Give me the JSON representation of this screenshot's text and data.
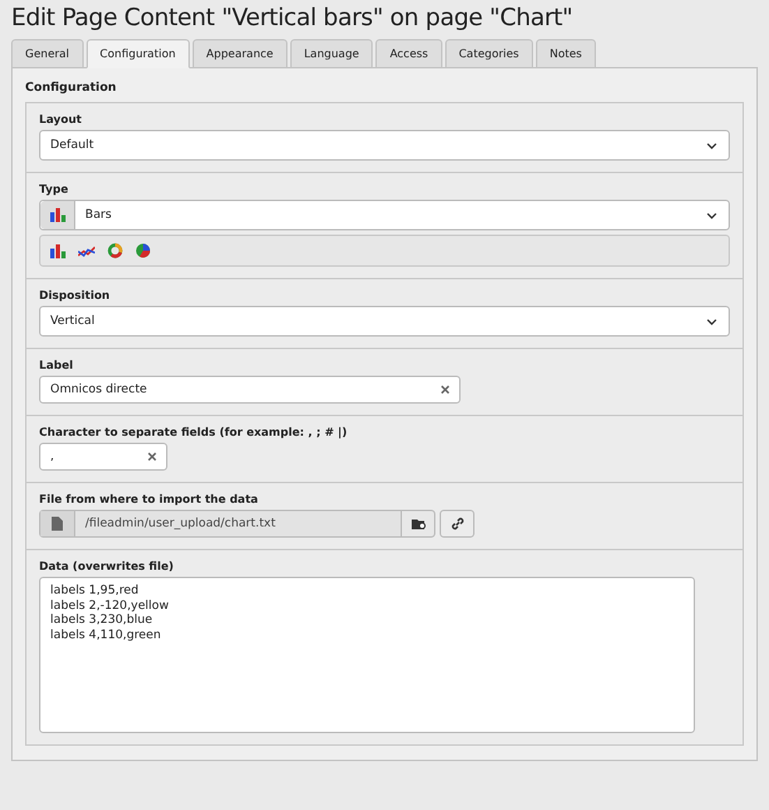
{
  "title": "Edit Page Content \"Vertical bars\" on page \"Chart\"",
  "tabs": [
    {
      "label": "General",
      "selected": false
    },
    {
      "label": "Configuration",
      "selected": true
    },
    {
      "label": "Appearance",
      "selected": false
    },
    {
      "label": "Language",
      "selected": false
    },
    {
      "label": "Access",
      "selected": false
    },
    {
      "label": "Categories",
      "selected": false
    },
    {
      "label": "Notes",
      "selected": false
    }
  ],
  "fieldset_title": "Configuration",
  "sections": [
    {
      "kind": "select",
      "label": "Layout",
      "value": "Default"
    },
    {
      "kind": "chart_select",
      "label": "Type",
      "value": "Bars"
    },
    {
      "kind": "select",
      "label": "Disposition",
      "value": "Vertical"
    },
    {
      "kind": "text",
      "label": "Label",
      "value": "Omnicos directe"
    },
    {
      "kind": "short_text",
      "label": "Character to separate fields (for example: , ; # |)",
      "value": ","
    },
    {
      "kind": "file",
      "label": "File from where to import the data",
      "value": "/fileadmin/user_upload/chart.txt"
    },
    {
      "kind": "textarea",
      "label": "Data (overwrites file)",
      "value": "labels 1,95,red\nlabels 2,-120,yellow\nlabels 3,230,blue\nlabels 4,110,green"
    }
  ]
}
